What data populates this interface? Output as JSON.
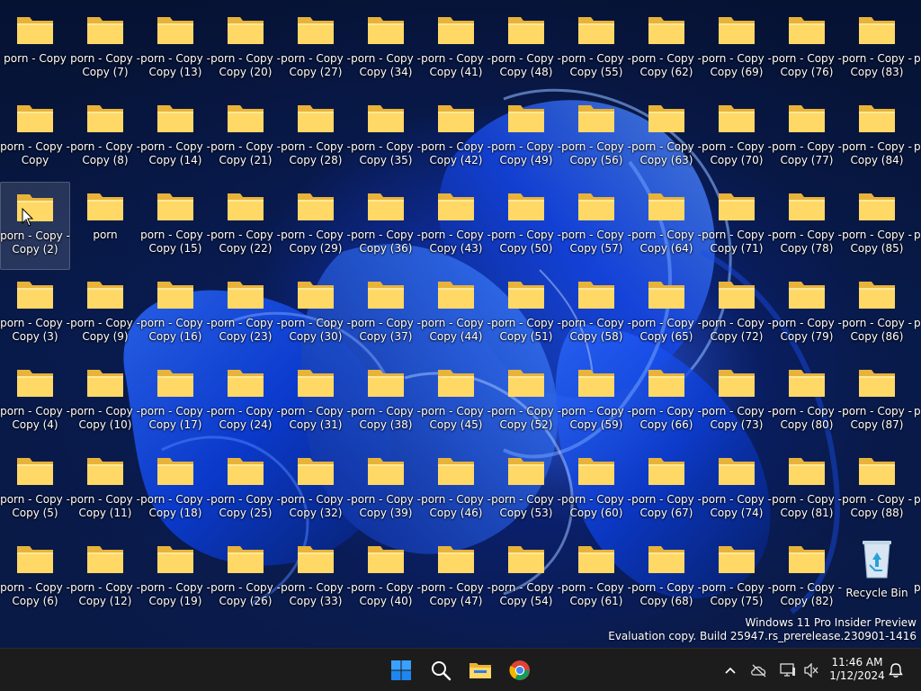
{
  "desktop": {
    "columns": [
      [
        "porn - Copy",
        "porn - Copy - Copy",
        "porn - Copy - Copy (2)",
        "porn - Copy - Copy (3)",
        "porn - Copy - Copy (4)",
        "porn - Copy - Copy (5)",
        "porn - Copy - Copy (6)"
      ],
      [
        "porn - Copy - Copy (7)",
        "porn - Copy - Copy (8)",
        "porn",
        "porn - Copy - Copy (9)",
        "porn - Copy - Copy (10)",
        "porn - Copy - Copy (11)",
        "porn - Copy - Copy (12)"
      ],
      [
        "porn - Copy - Copy (13)",
        "porn - Copy - Copy (14)",
        "porn - Copy - Copy (15)",
        "porn - Copy - Copy (16)",
        "porn - Copy - Copy (17)",
        "porn - Copy - Copy (18)",
        "porn - Copy - Copy (19)"
      ],
      [
        "porn - Copy - Copy (20)",
        "porn - Copy - Copy (21)",
        "porn - Copy - Copy (22)",
        "porn - Copy - Copy (23)",
        "porn - Copy - Copy (24)",
        "porn - Copy - Copy (25)",
        "porn - Copy - Copy (26)"
      ],
      [
        "porn - Copy - Copy (27)",
        "porn - Copy - Copy (28)",
        "porn - Copy - Copy (29)",
        "porn - Copy - Copy (30)",
        "porn - Copy - Copy (31)",
        "porn - Copy - Copy (32)",
        "porn - Copy - Copy (33)"
      ],
      [
        "porn - Copy - Copy (34)",
        "porn - Copy - Copy (35)",
        "porn - Copy - Copy (36)",
        "porn - Copy - Copy (37)",
        "porn - Copy - Copy (38)",
        "porn - Copy - Copy (39)",
        "porn - Copy - Copy (40)"
      ],
      [
        "porn - Copy - Copy (41)",
        "porn - Copy - Copy (42)",
        "porn - Copy - Copy (43)",
        "porn - Copy - Copy (44)",
        "porn - Copy - Copy (45)",
        "porn - Copy - Copy (46)",
        "porn - Copy - Copy (47)"
      ],
      [
        "porn - Copy - Copy (48)",
        "porn - Copy - Copy (49)",
        "porn - Copy - Copy (50)",
        "porn - Copy - Copy (51)",
        "porn - Copy - Copy (52)",
        "porn - Copy - Copy (53)",
        "porn - Copy - Copy (54)"
      ],
      [
        "porn - Copy - Copy (55)",
        "porn - Copy - Copy (56)",
        "porn - Copy - Copy (57)",
        "porn - Copy - Copy (58)",
        "porn - Copy - Copy (59)",
        "porn - Copy - Copy (60)",
        "porn - Copy - Copy (61)"
      ],
      [
        "porn - Copy - Copy (62)",
        "porn - Copy - Copy (63)",
        "porn - Copy - Copy (64)",
        "porn - Copy - Copy (65)",
        "porn - Copy - Copy (66)",
        "porn - Copy - Copy (67)",
        "porn - Copy - Copy (68)"
      ],
      [
        "porn - Copy - Copy (69)",
        "porn - Copy - Copy (70)",
        "porn - Copy - Copy (71)",
        "porn - Copy - Copy (72)",
        "porn - Copy - Copy (73)",
        "porn - Copy - Copy (74)",
        "porn - Copy - Copy (75)"
      ],
      [
        "porn - Copy - Copy (76)",
        "porn - Copy - Copy (77)",
        "porn - Copy - Copy (78)",
        "porn - Copy - Copy (79)",
        "porn - Copy - Copy (80)",
        "porn - Copy - Copy (81)",
        "porn - Copy - Copy (82)"
      ],
      [
        "porn - Copy - Copy (83)",
        "porn - Copy - Copy (84)",
        "porn - Copy - Copy (85)",
        "porn - Copy - Copy (86)",
        "porn - Copy - Copy (87)",
        "porn - Copy - Copy (88)",
        "Recycle Bin"
      ]
    ],
    "edge_column_label": "p",
    "selected_icon": "porn - Copy - Copy (2)",
    "folder_icon": "folder-icon",
    "recycle_icon": "recycle-bin-icon"
  },
  "watermark": {
    "line1": "Windows 11 Pro Insider Preview",
    "line2": "Evaluation copy. Build 25947.rs_prerelease.230901-1416"
  },
  "taskbar": {
    "apps": [
      {
        "name": "start",
        "icon": "windows-logo-icon"
      },
      {
        "name": "search",
        "icon": "search-icon"
      },
      {
        "name": "file-explorer",
        "icon": "file-explorer-icon"
      },
      {
        "name": "chrome",
        "icon": "chrome-icon"
      }
    ],
    "tray": {
      "chevron_icon": "chevron-up-icon",
      "onedrive_icon": "onedrive-offline-icon",
      "network_icon": "network-icon",
      "volume_icon": "volume-muted-icon",
      "notification_icon": "bell-icon"
    },
    "clock": {
      "time": "11:46 AM",
      "date": "1/12/2024"
    }
  },
  "colors": {
    "taskbar_bg": "#1c1c1c",
    "folder_front": "#ffd866",
    "folder_back": "#e8b33a",
    "accent": "#0078d4"
  }
}
